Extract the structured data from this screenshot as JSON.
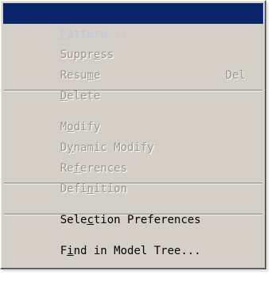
{
  "menu": {
    "items": [
      {
        "pre": "",
        "ul": "P",
        "post": "attern...",
        "accel": "",
        "state": "selected"
      },
      {
        "pre": "Suppr",
        "ul": "e",
        "post": "ss",
        "accel": "",
        "state": "disabled"
      },
      {
        "pre": "Resu",
        "ul": "m",
        "post": "e",
        "accel": "",
        "state": "disabled"
      },
      {
        "pre": "",
        "ul": "D",
        "post": "elete",
        "accel": "Del",
        "state": "disabled"
      },
      {
        "pre": "M",
        "ul": "o",
        "post": "dify",
        "accel": "",
        "state": "disabled"
      },
      {
        "pre": "D",
        "ul": "y",
        "post": "namic Modify",
        "accel": "",
        "state": "disabled"
      },
      {
        "pre": "Re",
        "ul": "f",
        "post": "erences",
        "accel": "",
        "state": "disabled"
      },
      {
        "pre": "Defi",
        "ul": "n",
        "post": "ition",
        "accel": "",
        "state": "disabled"
      },
      {
        "pre": "Sele",
        "ul": "c",
        "post": "tion Preferences",
        "accel": "",
        "state": "enabled"
      },
      {
        "pre": "F",
        "ul": "i",
        "post": "nd in Model Tree...",
        "accel": "",
        "state": "enabled"
      }
    ]
  }
}
